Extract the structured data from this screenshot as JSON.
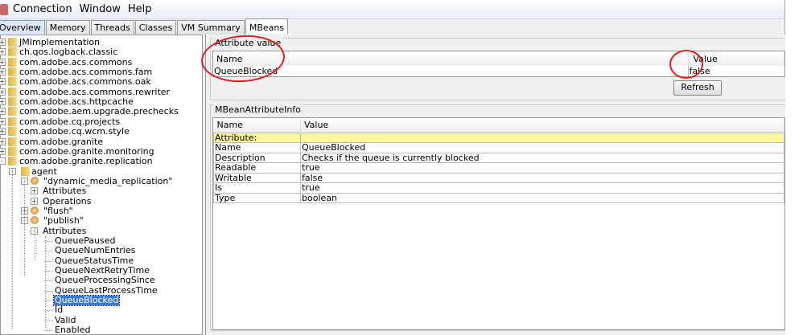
{
  "menu": [
    "Connection",
    "Window",
    "Help"
  ],
  "tabs": [
    "Overview",
    "Memory",
    "Threads",
    "Classes",
    "VM Summary",
    "MBeans"
  ],
  "tree": [
    {
      "label": "JMImplementation",
      "level": 0,
      "type": "folder",
      "exp": "+"
    },
    {
      "label": "ch.qos.logback.classic",
      "level": 0,
      "type": "folder",
      "exp": "+"
    },
    {
      "label": "com.adobe.acs.commons",
      "level": 0,
      "type": "folder",
      "exp": "+"
    },
    {
      "label": "com.adobe.acs.commons.fam",
      "level": 0,
      "type": "folder",
      "exp": "+"
    },
    {
      "label": "com.adobe.acs.commons.oak",
      "level": 0,
      "type": "folder",
      "exp": "+"
    },
    {
      "label": "com.adobe.acs.commons.rewriter",
      "level": 0,
      "type": "folder",
      "exp": "+"
    },
    {
      "label": "com.adobe.acs.httpcache",
      "level": 0,
      "type": "folder",
      "exp": "+"
    },
    {
      "label": "com.adobe.aem.upgrade.prechecks",
      "level": 0,
      "type": "folder",
      "exp": "+"
    },
    {
      "label": "com.adobe.cq.projects",
      "level": 0,
      "type": "folder",
      "exp": "+"
    },
    {
      "label": "com.adobe.cq.wcm.style",
      "level": 0,
      "type": "folder",
      "exp": "+"
    },
    {
      "label": "com.adobe.granite",
      "level": 0,
      "type": "folder",
      "exp": "+"
    },
    {
      "label": "com.adobe.granite.monitoring",
      "level": 0,
      "type": "folder",
      "exp": "+"
    },
    {
      "label": "com.adobe.granite.replication",
      "level": 0,
      "type": "folder",
      "exp": "-"
    },
    {
      "label": "agent",
      "level": 1,
      "type": "folder",
      "exp": "-"
    },
    {
      "label": "\"dynamic_media_replication\"",
      "level": 2,
      "type": "bean",
      "exp": "-"
    },
    {
      "label": "Attributes",
      "level": 3,
      "type": "none",
      "exp": "+"
    },
    {
      "label": "Operations",
      "level": 3,
      "type": "none",
      "exp": "+"
    },
    {
      "label": "\"flush\"",
      "level": 2,
      "type": "bean",
      "exp": "+"
    },
    {
      "label": "\"publish\"",
      "level": 2,
      "type": "bean",
      "exp": "-"
    },
    {
      "label": "Attributes",
      "level": 3,
      "type": "none",
      "exp": "-"
    },
    {
      "label": "QueuePaused",
      "level": 4,
      "type": "leaf"
    },
    {
      "label": "QueueNumEntries",
      "level": 4,
      "type": "leaf"
    },
    {
      "label": "QueueStatusTime",
      "level": 4,
      "type": "leaf"
    },
    {
      "label": "QueueNextRetryTime",
      "level": 4,
      "type": "leaf"
    },
    {
      "label": "QueueProcessingSince",
      "level": 4,
      "type": "leaf"
    },
    {
      "label": "QueueLastProcessTime",
      "level": 4,
      "type": "leaf"
    },
    {
      "label": "QueueBlocked",
      "level": 4,
      "type": "leaf",
      "selected": true
    },
    {
      "label": "Id",
      "level": 4,
      "type": "leaf"
    },
    {
      "label": "Valid",
      "level": 4,
      "type": "leaf"
    },
    {
      "label": "Enabled",
      "level": 4,
      "type": "leaf"
    }
  ],
  "attr_value": {
    "title": "Attribute value",
    "col_name": "Name",
    "col_value": "Value",
    "name": "QueueBlocked",
    "value": "false",
    "refresh": "Refresh"
  },
  "info": {
    "title": "MBeanAttributeInfo",
    "col_name": "Name",
    "col_value": "Value",
    "rows": [
      [
        "Attribute:",
        ""
      ],
      [
        "Name",
        "QueueBlocked"
      ],
      [
        "Description",
        "Checks if the queue is currently blocked"
      ],
      [
        "Readable",
        "true"
      ],
      [
        "Writable",
        "false"
      ],
      [
        "Is",
        "true"
      ],
      [
        "Type",
        "boolean"
      ]
    ]
  },
  "colors": {
    "annotation": "#e02020",
    "highlight_row": "#fff799",
    "selection": "#3a7bd5"
  }
}
